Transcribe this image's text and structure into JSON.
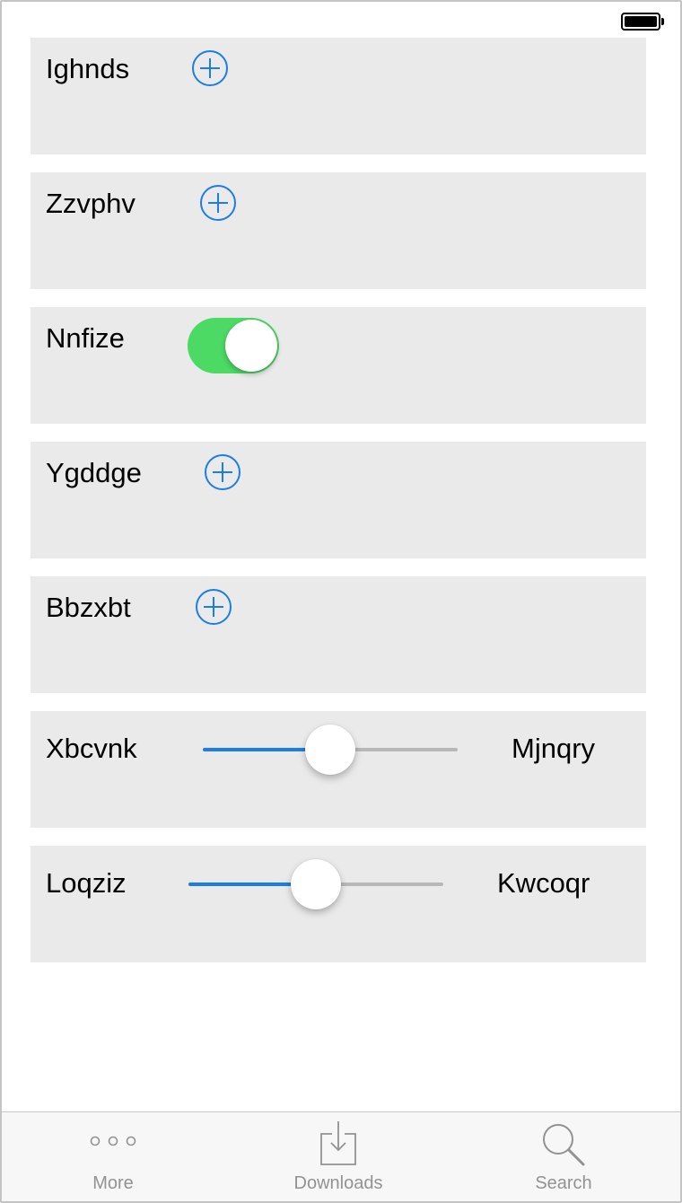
{
  "rows": [
    {
      "label": "Ighnds",
      "control": "add-button"
    },
    {
      "label": "Zzvphv",
      "control": "add-button"
    },
    {
      "label": "Nnfize",
      "control": "toggle",
      "toggle_on": true,
      "toggle_color": "#4cd964"
    },
    {
      "label": "Ygddge",
      "control": "add-button"
    },
    {
      "label": "Bbzxbt",
      "control": "add-button"
    },
    {
      "label": "Xbcvnk",
      "control": "slider",
      "slider_value": 0.5,
      "max_label": "Mjnqry"
    },
    {
      "label": "Loqziz",
      "control": "slider",
      "slider_value": 0.5,
      "max_label": "Kwcoqr"
    }
  ],
  "tabbar": {
    "tabs": [
      {
        "label": "More",
        "icon": "more-icon"
      },
      {
        "label": "Downloads",
        "icon": "downloads-icon"
      },
      {
        "label": "Search",
        "icon": "search-icon"
      }
    ]
  },
  "colors": {
    "accent": "#1b7ee6",
    "row_background": "#eaeaea",
    "tab_inactive": "#929292"
  }
}
